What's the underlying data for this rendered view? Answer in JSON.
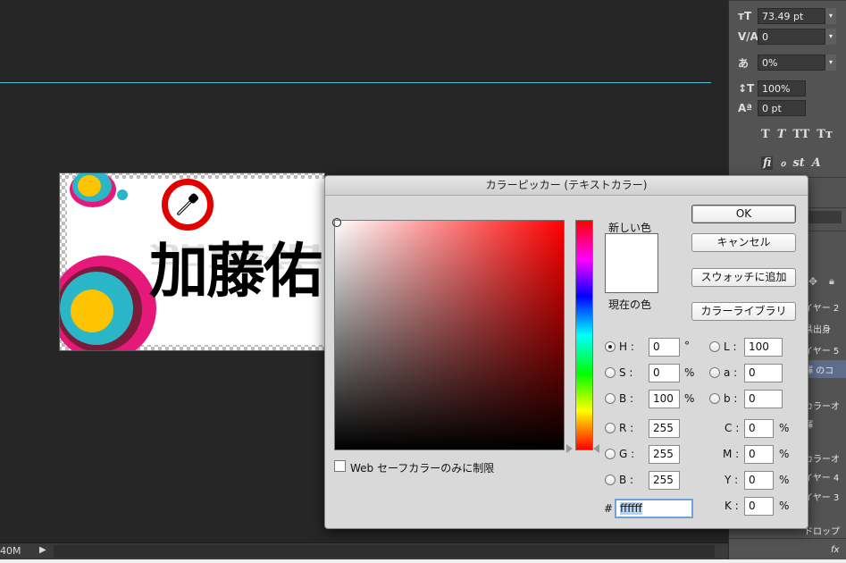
{
  "document": {
    "name_text": "加藤佑"
  },
  "status": {
    "zoom": "40M",
    "arrow": "▶"
  },
  "char_panel": {
    "font_size": "73.49 pt",
    "kerning": "0",
    "tracking": "0%",
    "vscale": "100%",
    "baseline": "0 pt",
    "styles": [
      "T",
      "T",
      "TT",
      "Tт"
    ],
    "ot_styles": [
      "fi",
      "ℴ",
      "st",
      "A"
    ],
    "layers": [
      "イヤー 2",
      "県出身",
      "イヤー 5",
      "輝 のコ",
      "カラーオ",
      "輝",
      "カラーオ",
      "イヤー 4",
      "イヤー 3",
      "ドロップ",
      "fx"
    ]
  },
  "dialog": {
    "title": "カラーピッカー (テキストカラー)",
    "new_label": "新しい色",
    "current_label": "現在の色",
    "new_color": "#ffffff",
    "current_color": "#ffffff",
    "buttons": {
      "ok": "OK",
      "cancel": "キャンセル",
      "add_swatch": "スウォッチに追加",
      "libraries": "カラーライブラリ"
    },
    "web_safe_label": "Web セーフカラーのみに制限",
    "web_safe_checked": false,
    "hsb": {
      "h_label": "H :",
      "h": "0",
      "h_unit": "°",
      "s_label": "S :",
      "s": "0",
      "s_unit": "%",
      "b_label": "B :",
      "b": "100",
      "b_unit": "%"
    },
    "rgb": {
      "r_label": "R :",
      "r": "255",
      "g_label": "G :",
      "g": "255",
      "b_label": "B :",
      "b": "255"
    },
    "lab": {
      "l_label": "L :",
      "l": "100",
      "a_label": "a :",
      "a": "0",
      "b_label": "b :",
      "b": "0"
    },
    "cmyk": {
      "c_label": "C :",
      "c": "0",
      "c_unit": "%",
      "m_label": "M :",
      "m": "0",
      "m_unit": "%",
      "y_label": "Y :",
      "y": "0",
      "y_unit": "%",
      "k_label": "K :",
      "k": "0",
      "k_unit": "%"
    },
    "hex_label": "#",
    "hex": "ffffff",
    "selected_mode": "H"
  },
  "colors": {
    "guide": "#4fc3d4",
    "annotation_ring": "#e00000",
    "hex_focus": "#6fa2dc"
  }
}
